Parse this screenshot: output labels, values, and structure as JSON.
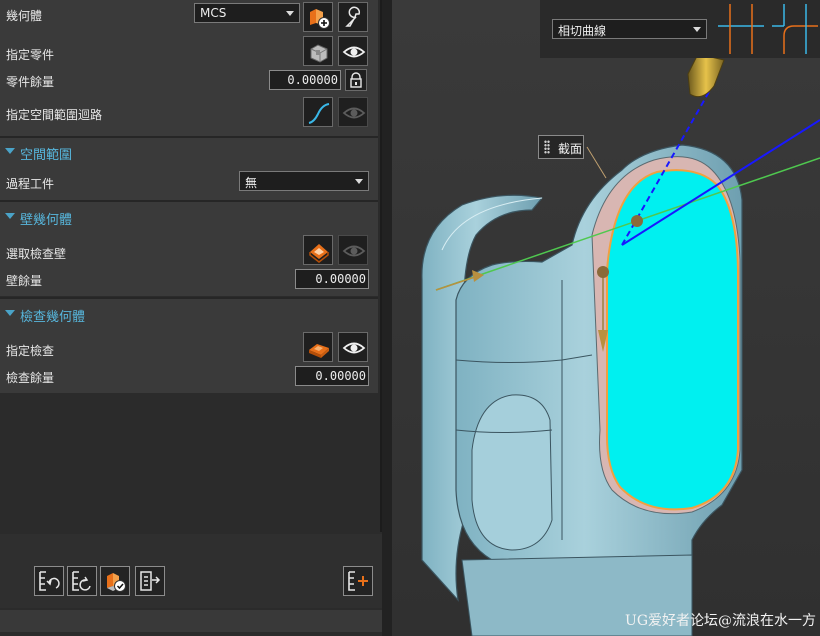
{
  "panel": {
    "geometry_row": {
      "label": "幾何體",
      "value": "MCS"
    },
    "part_row": {
      "label": "指定零件"
    },
    "part_stock_row": {
      "label": "零件餘量",
      "value": "0.00000"
    },
    "space_loop_row": {
      "label": "指定空間範圍迴路"
    },
    "space_section": {
      "title": "空間範圍",
      "process_work_label": "過程工件",
      "process_work_value": "無"
    },
    "wall_section": {
      "title": "壁幾何體",
      "select_wall_label": "選取檢查壁",
      "wall_stock_label": "壁餘量",
      "wall_stock_value": "0.00000"
    },
    "check_section": {
      "title": "檢查幾何體",
      "specify_check_label": "指定檢查",
      "check_stock_label": "檢查餘量",
      "check_stock_value": "0.00000"
    }
  },
  "viewport": {
    "curve_mode_value": "相切曲線",
    "section_tag": "截面",
    "watermark": "UG爱好者论坛@流浪在水一方"
  },
  "colors": {
    "accent": "#57b6dc",
    "cavity": "#00f0f0",
    "part": "#8fbfcc",
    "orange_icon": "#e8701a"
  }
}
